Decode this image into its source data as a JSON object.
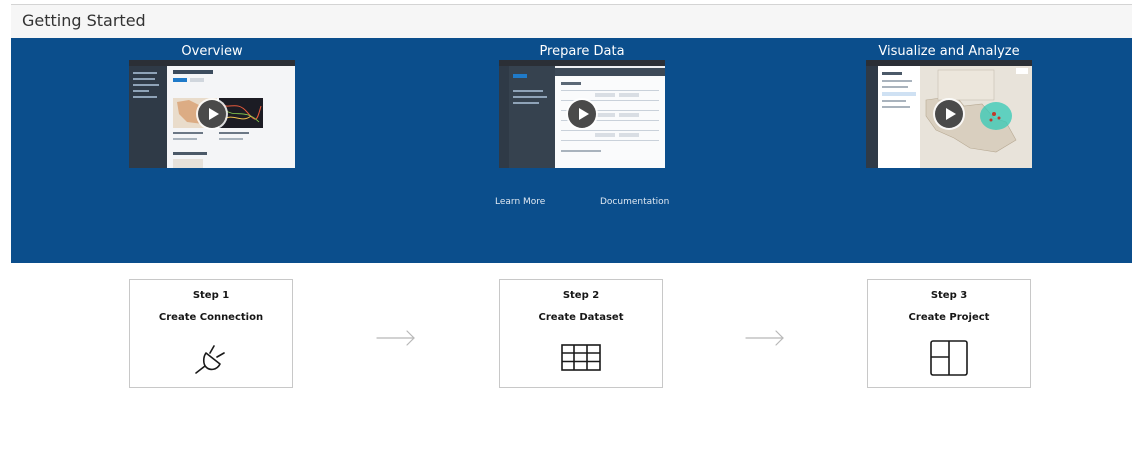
{
  "header": {
    "title": "Getting Started"
  },
  "videos": [
    {
      "title": "Overview",
      "thumb_icon": "projects-screenshot-thumbnail",
      "play_icon": "play-icon"
    },
    {
      "title": "Prepare Data",
      "thumb_icon": "dataset-screenshot-thumbnail",
      "play_icon": "play-icon"
    },
    {
      "title": "Visualize and Analyze",
      "thumb_icon": "map-screenshot-thumbnail",
      "play_icon": "play-icon"
    }
  ],
  "links": {
    "learn_more": "Learn More",
    "documentation": "Documentation"
  },
  "steps": [
    {
      "number": "Step 1",
      "name": "Create Connection",
      "icon": "plug-icon"
    },
    {
      "number": "Step 2",
      "name": "Create Dataset",
      "icon": "table-icon"
    },
    {
      "number": "Step 3",
      "name": "Create Project",
      "icon": "layout-icon"
    }
  ],
  "colors": {
    "hero_bg": "#0b4e8c",
    "header_bg": "#f6f6f6",
    "step_border": "#c8c8c8",
    "arrow": "#b8b8b8"
  }
}
